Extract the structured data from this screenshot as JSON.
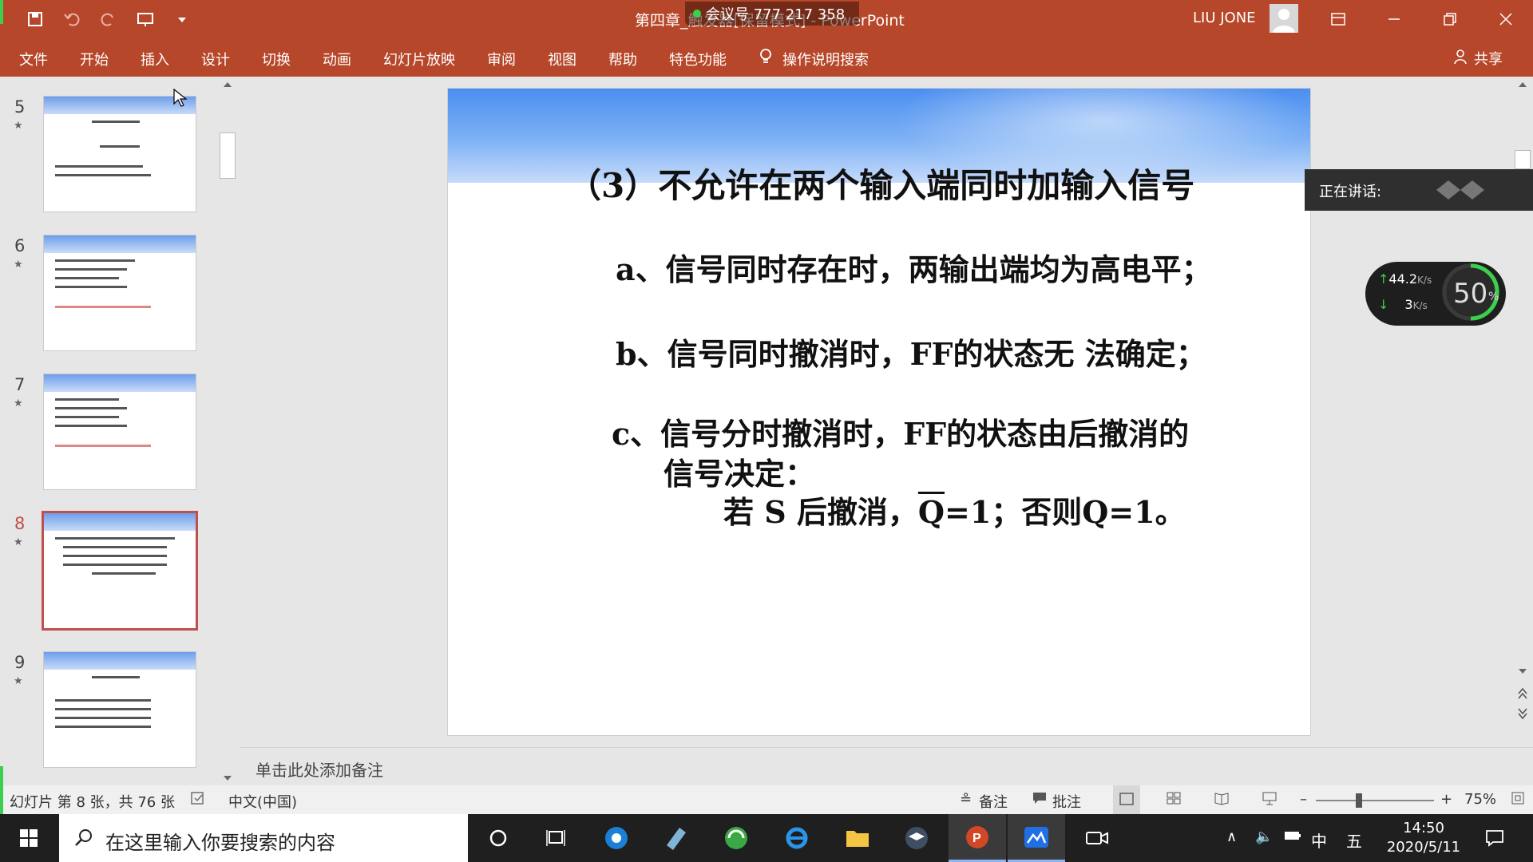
{
  "titlebar": {
    "doc_title": "第四章_触发器[保留模式] - PowerPoint",
    "meeting_id": "会议号 777 217 358",
    "user_name": "LIU JONE"
  },
  "ribbon": {
    "tabs": [
      "文件",
      "开始",
      "插入",
      "设计",
      "切换",
      "动画",
      "幻灯片放映",
      "审阅",
      "视图",
      "帮助",
      "特色功能"
    ],
    "tell_me": "操作说明搜索",
    "share": "共享"
  },
  "thumbnails": [
    {
      "num": "5",
      "selected": false
    },
    {
      "num": "6",
      "selected": false
    },
    {
      "num": "7",
      "selected": false
    },
    {
      "num": "8",
      "selected": true
    },
    {
      "num": "9",
      "selected": false
    }
  ],
  "slide": {
    "title": "（3）不允许在两个输入端同时加输入信号",
    "line_a": "a、信号同时存在时，两输出端均为高电平；",
    "line_b": "b、信号同时撤消时，FF的状态无 法确定；",
    "line_c1": "c、信号分时撤消时，FF的状态由后撤消的",
    "line_c2": "信号决定：",
    "line_d_pre": "若 S 后撤消，",
    "line_d_q": "Q",
    "line_d_post": "=1；否则Q=1。"
  },
  "notes_placeholder": "单击此处添加备注",
  "statusbar": {
    "slide_info": "幻灯片 第 8 张，共 76 张",
    "language": "中文(中国)",
    "notes": "备注",
    "comments": "批注",
    "zoom": "75%"
  },
  "overlay": {
    "speaking_label": "正在讲话:",
    "upload": "44.2",
    "download": "3",
    "speed_unit": "K/s",
    "percent": "50",
    "percent_unit": "%"
  },
  "taskbar": {
    "search_placeholder": "在这里输入你要搜索的内容",
    "ime_lang": "中",
    "ime_mode": "五",
    "time": "14:50",
    "date": "2020/5/11"
  },
  "colors": {
    "ribbon": "#b7472a",
    "accent_green": "#3ccf4e",
    "selected_thumb": "#c0504d"
  }
}
